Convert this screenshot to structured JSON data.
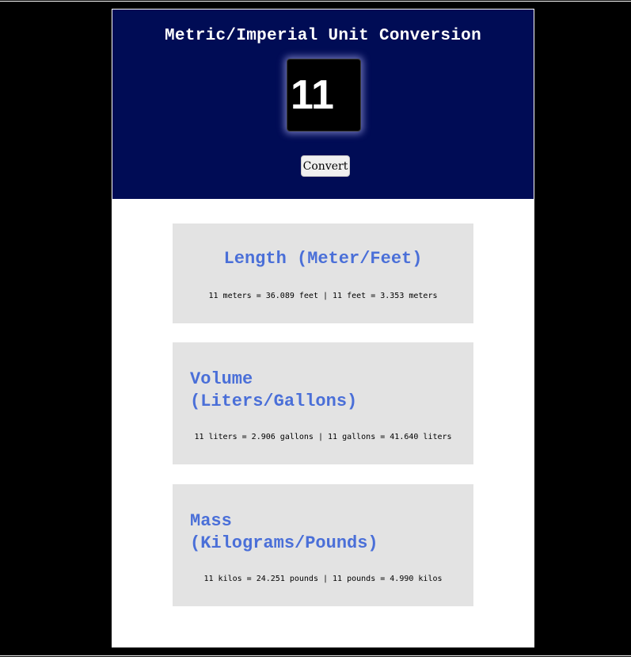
{
  "header": {
    "title": "Metric/Imperial Unit Conversion",
    "input_value": "11",
    "convert_label": "Convert",
    "background_color": "#000c55"
  },
  "cards": [
    {
      "title": "Length (Meter/Feet)",
      "result": "11 meters = 36.089 feet | 11 feet = 3.353 meters"
    },
    {
      "title": "Volume\n(Liters/Gallons)",
      "result": "11 liters = 2.906 gallons | 11 gallons = 41.640 liters"
    },
    {
      "title": "Mass\n(Kilograms/Pounds)",
      "result": "11 kilos = 24.251 pounds | 11 pounds = 4.990 kilos"
    }
  ],
  "colors": {
    "page_background": "#000000",
    "card_background": "#e3e3e3",
    "card_title": "#4a6fd8"
  }
}
